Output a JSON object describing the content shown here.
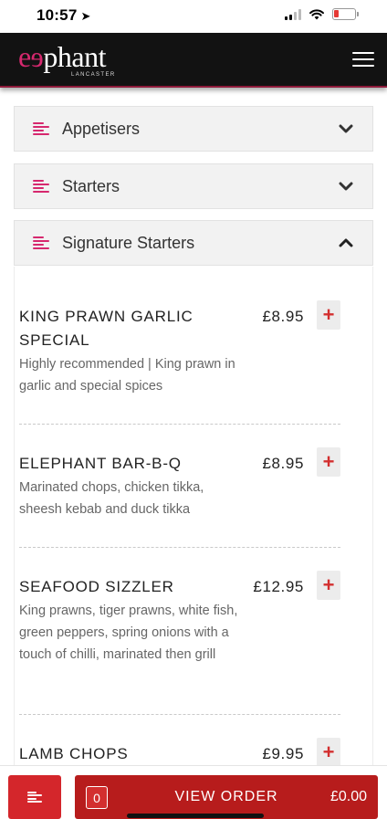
{
  "status_bar": {
    "time": "10:57"
  },
  "header": {
    "logo_prefix": "e",
    "logo_mirrored": "e",
    "logo_rest": "phant",
    "logo_sub": "LANCASTER"
  },
  "categories": [
    {
      "label": "Appetisers",
      "state": "collapsed"
    },
    {
      "label": "Starters",
      "state": "collapsed"
    },
    {
      "label": "Signature Starters",
      "state": "expanded"
    }
  ],
  "items": [
    {
      "name": "KING PRAWN GARLIC SPECIAL",
      "price": "£8.95",
      "description": "Highly recommended | King prawn in garlic and special spices"
    },
    {
      "name": "ELEPHANT BAR-B-Q",
      "price": "£8.95",
      "description": "Marinated chops, chicken tikka, sheesh kebab and duck tikka"
    },
    {
      "name": "SEAFOOD SIZZLER",
      "price": "£12.95",
      "description": "King prawns, tiger prawns, white fish, green peppers, spring onions with a touch of chilli, marinated then grill"
    },
    {
      "name": "LAMB CHOPS",
      "price": "£9.95",
      "description": ""
    }
  ],
  "add_label": "+",
  "footer": {
    "order_count": "0",
    "order_label": "VIEW ORDER",
    "order_total": "£0.00"
  },
  "colors": {
    "header_bg": "#121212",
    "brand_pink": "#d6286e",
    "order_red": "#b71c1c",
    "menu_red": "#d4262b",
    "add_red": "#d32f2f"
  },
  "icons": {
    "location": "location-arrow-icon",
    "signal": "cellular-signal-icon",
    "wifi": "wifi-icon",
    "battery": "battery-icon",
    "menu": "hamburger-menu-icon",
    "category": "menu-lines-icon",
    "collapsed": "chevron-down-icon",
    "expanded": "chevron-up-icon",
    "add": "plus-icon"
  }
}
